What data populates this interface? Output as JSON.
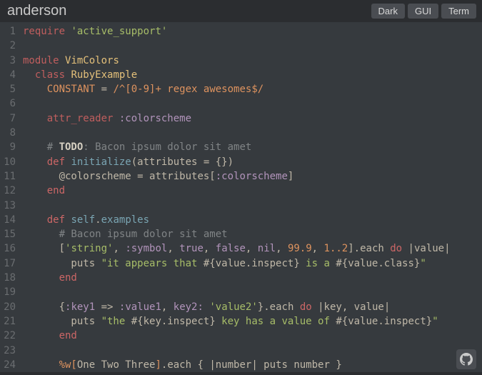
{
  "title": "anderson",
  "tabs": {
    "dark": "Dark",
    "gui": "GUI",
    "term": "Term"
  },
  "github_icon_label": "github",
  "code": {
    "1": [
      [
        "kw",
        "require"
      ],
      [
        "id",
        " "
      ],
      [
        "str",
        "'active_support'"
      ]
    ],
    "2": [],
    "3": [
      [
        "kw",
        "module"
      ],
      [
        "id",
        " "
      ],
      [
        "mod",
        "VimColors"
      ]
    ],
    "4": [
      [
        "id",
        "  "
      ],
      [
        "kw",
        "class"
      ],
      [
        "id",
        " "
      ],
      [
        "mod",
        "RubyExample"
      ]
    ],
    "5": [
      [
        "id",
        "    "
      ],
      [
        "const",
        "CONSTANT"
      ],
      [
        "id",
        " = "
      ],
      [
        "num",
        "/^[0-9]+ regex awesomes$/"
      ]
    ],
    "6": [],
    "7": [
      [
        "id",
        "    "
      ],
      [
        "kw",
        "attr_reader"
      ],
      [
        "id",
        " "
      ],
      [
        "sym",
        ":colorscheme"
      ]
    ],
    "8": [],
    "9": [
      [
        "id",
        "    "
      ],
      [
        "cmt",
        "# "
      ],
      [
        "todo",
        "TODO"
      ],
      [
        "cmt",
        ": Bacon ipsum dolor sit amet"
      ]
    ],
    "10": [
      [
        "id",
        "    "
      ],
      [
        "kw2",
        "def"
      ],
      [
        "id",
        " "
      ],
      [
        "fn",
        "initialize"
      ],
      [
        "id",
        "(attributes = {})"
      ]
    ],
    "11": [
      [
        "id",
        "      "
      ],
      [
        "ivar",
        "@colorscheme"
      ],
      [
        "id",
        " = attributes["
      ],
      [
        "sym",
        ":colorscheme"
      ],
      [
        "id",
        "]"
      ]
    ],
    "12": [
      [
        "id",
        "    "
      ],
      [
        "kw2",
        "end"
      ]
    ],
    "13": [],
    "14": [
      [
        "id",
        "    "
      ],
      [
        "kw2",
        "def"
      ],
      [
        "id",
        " "
      ],
      [
        "fn",
        "self"
      ],
      [
        "id",
        "."
      ],
      [
        "fn",
        "examples"
      ]
    ],
    "15": [
      [
        "id",
        "      "
      ],
      [
        "cmt",
        "# Bacon ipsum dolor sit amet"
      ]
    ],
    "16": [
      [
        "id",
        "      ["
      ],
      [
        "str",
        "'string'"
      ],
      [
        "id",
        ", "
      ],
      [
        "sym",
        ":symbol"
      ],
      [
        "id",
        ", "
      ],
      [
        "sym",
        "true"
      ],
      [
        "id",
        ", "
      ],
      [
        "sym",
        "false"
      ],
      [
        "id",
        ", "
      ],
      [
        "sym",
        "nil"
      ],
      [
        "id",
        ", "
      ],
      [
        "num",
        "99.9"
      ],
      [
        "id",
        ", "
      ],
      [
        "num",
        "1..2"
      ],
      [
        "id",
        "].each "
      ],
      [
        "kw2",
        "do"
      ],
      [
        "id",
        " |value|"
      ]
    ],
    "17": [
      [
        "id",
        "        puts "
      ],
      [
        "str",
        "\"it appears that "
      ],
      [
        "interp",
        "#{"
      ],
      [
        "id",
        "value.inspect"
      ],
      [
        "interp",
        "}"
      ],
      [
        "str",
        " is a "
      ],
      [
        "interp",
        "#{"
      ],
      [
        "id",
        "value.class"
      ],
      [
        "interp",
        "}"
      ],
      [
        "str",
        "\""
      ]
    ],
    "18": [
      [
        "id",
        "      "
      ],
      [
        "kw2",
        "end"
      ]
    ],
    "19": [],
    "20": [
      [
        "id",
        "      {"
      ],
      [
        "sym",
        ":key1"
      ],
      [
        "id",
        " => "
      ],
      [
        "sym",
        ":value1"
      ],
      [
        "id",
        ", "
      ],
      [
        "sym",
        "key2:"
      ],
      [
        "id",
        " "
      ],
      [
        "str",
        "'value2'"
      ],
      [
        "id",
        "}.each "
      ],
      [
        "kw2",
        "do"
      ],
      [
        "id",
        " |key, value|"
      ]
    ],
    "21": [
      [
        "id",
        "        puts "
      ],
      [
        "str",
        "\"the "
      ],
      [
        "interp",
        "#{"
      ],
      [
        "id",
        "key.inspect"
      ],
      [
        "interp",
        "}"
      ],
      [
        "str",
        " key has a value of "
      ],
      [
        "interp",
        "#{"
      ],
      [
        "id",
        "value.inspect"
      ],
      [
        "interp",
        "}"
      ],
      [
        "str",
        "\""
      ]
    ],
    "22": [
      [
        "id",
        "      "
      ],
      [
        "kw2",
        "end"
      ]
    ],
    "23": [],
    "24": [
      [
        "id",
        "      "
      ],
      [
        "num",
        "%w["
      ],
      [
        "id",
        "One Two Three"
      ],
      [
        "num",
        "]"
      ],
      [
        "id",
        ".each { |number| puts number }"
      ]
    ]
  }
}
